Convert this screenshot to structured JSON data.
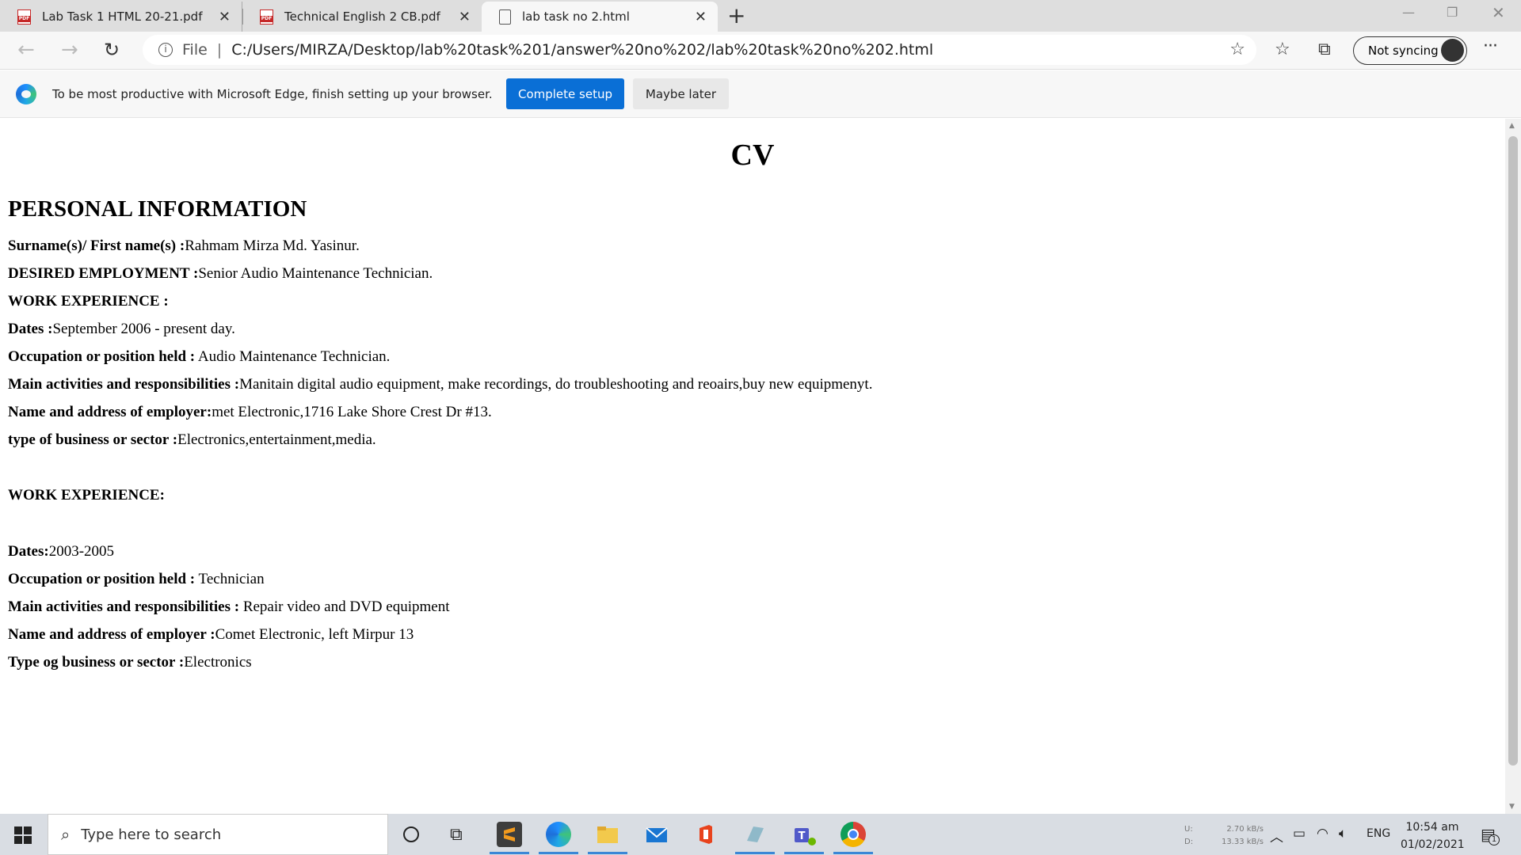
{
  "browser": {
    "tabs": [
      {
        "label": "Lab Task 1 HTML 20-21.pdf",
        "icon": "pdf-icon",
        "active": false
      },
      {
        "label": "Technical English 2 CB.pdf",
        "icon": "pdf-icon",
        "active": false
      },
      {
        "label": "lab task no 2.html",
        "icon": "file-icon",
        "active": true
      }
    ],
    "address": {
      "scheme": "File",
      "url": "C:/Users/MIRZA/Desktop/lab%20task%201/answer%20no%202/lab%20task%20no%202.html"
    },
    "sync_label": "Not syncing",
    "infobar": {
      "message": "To be most productive with Microsoft Edge, finish setting up your browser.",
      "primary_button": "Complete setup",
      "secondary_button": "Maybe later"
    }
  },
  "page": {
    "title": "CV",
    "section_heading": "PERSONAL INFORMATION",
    "rows": [
      {
        "label": "Surname(s)/ First name(s) :",
        "value": "Rahmam Mirza Md. Yasinur."
      },
      {
        "label": "DESIRED EMPLOYMENT :",
        "value": "Senior Audio Maintenance Technician."
      },
      {
        "label": "WORK EXPERIENCE :",
        "value": ""
      },
      {
        "label": "Dates :",
        "value": "September 2006 - present day."
      },
      {
        "label": "Occupation or position held :",
        "value": " Audio Maintenance Technician."
      },
      {
        "label": "Main activities and responsibilities :",
        "value": "Manitain digital audio equipment, make recordings, do troubleshooting and reoairs,buy new equipmenyt."
      },
      {
        "label": "Name and address of employer:",
        "value": "met Electronic,1716 Lake Shore Crest Dr #13."
      },
      {
        "label": "type of business or sector :",
        "value": "Electronics,entertainment,media."
      },
      {
        "label": "WORK EXPERIENCE:",
        "value": ""
      },
      {
        "label": "Dates:",
        "value": "2003-2005"
      },
      {
        "label": "Occupation or position held :",
        "value": " Technician"
      },
      {
        "label": "Main activities and responsibilities :",
        "value": " Repair video and DVD equipment"
      },
      {
        "label": "Name and address of employer :",
        "value": "Comet Electronic, left Mirpur 13"
      },
      {
        "label": "Type og business or sector :",
        "value": "Electronics"
      }
    ]
  },
  "taskbar": {
    "search_placeholder": "Type here to search",
    "net_upload_label": "U:",
    "net_download_label": "D:",
    "net_upload": "2.70 kB/s",
    "net_download": "13.33 kB/s",
    "language": "ENG",
    "time": "10:54 am",
    "date": "01/02/2021",
    "notification_count": "1"
  }
}
